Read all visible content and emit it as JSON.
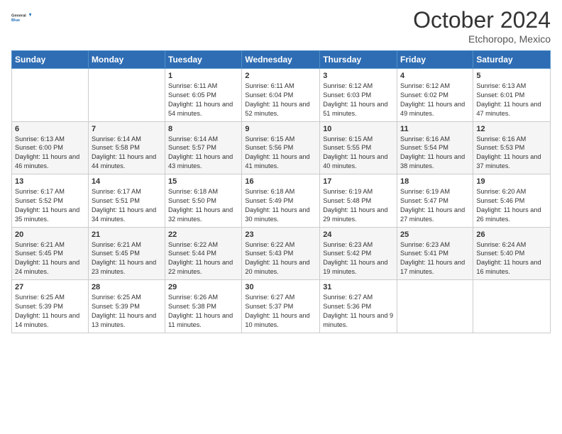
{
  "header": {
    "logo_text_general": "General",
    "logo_text_blue": "Blue",
    "month": "October 2024",
    "location": "Etchoropo, Mexico"
  },
  "weekdays": [
    "Sunday",
    "Monday",
    "Tuesday",
    "Wednesday",
    "Thursday",
    "Friday",
    "Saturday"
  ],
  "weeks": [
    [
      {
        "day": "",
        "sunrise": "",
        "sunset": "",
        "daylight": ""
      },
      {
        "day": "",
        "sunrise": "",
        "sunset": "",
        "daylight": ""
      },
      {
        "day": "1",
        "sunrise": "Sunrise: 6:11 AM",
        "sunset": "Sunset: 6:05 PM",
        "daylight": "Daylight: 11 hours and 54 minutes."
      },
      {
        "day": "2",
        "sunrise": "Sunrise: 6:11 AM",
        "sunset": "Sunset: 6:04 PM",
        "daylight": "Daylight: 11 hours and 52 minutes."
      },
      {
        "day": "3",
        "sunrise": "Sunrise: 6:12 AM",
        "sunset": "Sunset: 6:03 PM",
        "daylight": "Daylight: 11 hours and 51 minutes."
      },
      {
        "day": "4",
        "sunrise": "Sunrise: 6:12 AM",
        "sunset": "Sunset: 6:02 PM",
        "daylight": "Daylight: 11 hours and 49 minutes."
      },
      {
        "day": "5",
        "sunrise": "Sunrise: 6:13 AM",
        "sunset": "Sunset: 6:01 PM",
        "daylight": "Daylight: 11 hours and 47 minutes."
      }
    ],
    [
      {
        "day": "6",
        "sunrise": "Sunrise: 6:13 AM",
        "sunset": "Sunset: 6:00 PM",
        "daylight": "Daylight: 11 hours and 46 minutes."
      },
      {
        "day": "7",
        "sunrise": "Sunrise: 6:14 AM",
        "sunset": "Sunset: 5:58 PM",
        "daylight": "Daylight: 11 hours and 44 minutes."
      },
      {
        "day": "8",
        "sunrise": "Sunrise: 6:14 AM",
        "sunset": "Sunset: 5:57 PM",
        "daylight": "Daylight: 11 hours and 43 minutes."
      },
      {
        "day": "9",
        "sunrise": "Sunrise: 6:15 AM",
        "sunset": "Sunset: 5:56 PM",
        "daylight": "Daylight: 11 hours and 41 minutes."
      },
      {
        "day": "10",
        "sunrise": "Sunrise: 6:15 AM",
        "sunset": "Sunset: 5:55 PM",
        "daylight": "Daylight: 11 hours and 40 minutes."
      },
      {
        "day": "11",
        "sunrise": "Sunrise: 6:16 AM",
        "sunset": "Sunset: 5:54 PM",
        "daylight": "Daylight: 11 hours and 38 minutes."
      },
      {
        "day": "12",
        "sunrise": "Sunrise: 6:16 AM",
        "sunset": "Sunset: 5:53 PM",
        "daylight": "Daylight: 11 hours and 37 minutes."
      }
    ],
    [
      {
        "day": "13",
        "sunrise": "Sunrise: 6:17 AM",
        "sunset": "Sunset: 5:52 PM",
        "daylight": "Daylight: 11 hours and 35 minutes."
      },
      {
        "day": "14",
        "sunrise": "Sunrise: 6:17 AM",
        "sunset": "Sunset: 5:51 PM",
        "daylight": "Daylight: 11 hours and 34 minutes."
      },
      {
        "day": "15",
        "sunrise": "Sunrise: 6:18 AM",
        "sunset": "Sunset: 5:50 PM",
        "daylight": "Daylight: 11 hours and 32 minutes."
      },
      {
        "day": "16",
        "sunrise": "Sunrise: 6:18 AM",
        "sunset": "Sunset: 5:49 PM",
        "daylight": "Daylight: 11 hours and 30 minutes."
      },
      {
        "day": "17",
        "sunrise": "Sunrise: 6:19 AM",
        "sunset": "Sunset: 5:48 PM",
        "daylight": "Daylight: 11 hours and 29 minutes."
      },
      {
        "day": "18",
        "sunrise": "Sunrise: 6:19 AM",
        "sunset": "Sunset: 5:47 PM",
        "daylight": "Daylight: 11 hours and 27 minutes."
      },
      {
        "day": "19",
        "sunrise": "Sunrise: 6:20 AM",
        "sunset": "Sunset: 5:46 PM",
        "daylight": "Daylight: 11 hours and 26 minutes."
      }
    ],
    [
      {
        "day": "20",
        "sunrise": "Sunrise: 6:21 AM",
        "sunset": "Sunset: 5:45 PM",
        "daylight": "Daylight: 11 hours and 24 minutes."
      },
      {
        "day": "21",
        "sunrise": "Sunrise: 6:21 AM",
        "sunset": "Sunset: 5:45 PM",
        "daylight": "Daylight: 11 hours and 23 minutes."
      },
      {
        "day": "22",
        "sunrise": "Sunrise: 6:22 AM",
        "sunset": "Sunset: 5:44 PM",
        "daylight": "Daylight: 11 hours and 22 minutes."
      },
      {
        "day": "23",
        "sunrise": "Sunrise: 6:22 AM",
        "sunset": "Sunset: 5:43 PM",
        "daylight": "Daylight: 11 hours and 20 minutes."
      },
      {
        "day": "24",
        "sunrise": "Sunrise: 6:23 AM",
        "sunset": "Sunset: 5:42 PM",
        "daylight": "Daylight: 11 hours and 19 minutes."
      },
      {
        "day": "25",
        "sunrise": "Sunrise: 6:23 AM",
        "sunset": "Sunset: 5:41 PM",
        "daylight": "Daylight: 11 hours and 17 minutes."
      },
      {
        "day": "26",
        "sunrise": "Sunrise: 6:24 AM",
        "sunset": "Sunset: 5:40 PM",
        "daylight": "Daylight: 11 hours and 16 minutes."
      }
    ],
    [
      {
        "day": "27",
        "sunrise": "Sunrise: 6:25 AM",
        "sunset": "Sunset: 5:39 PM",
        "daylight": "Daylight: 11 hours and 14 minutes."
      },
      {
        "day": "28",
        "sunrise": "Sunrise: 6:25 AM",
        "sunset": "Sunset: 5:39 PM",
        "daylight": "Daylight: 11 hours and 13 minutes."
      },
      {
        "day": "29",
        "sunrise": "Sunrise: 6:26 AM",
        "sunset": "Sunset: 5:38 PM",
        "daylight": "Daylight: 11 hours and 11 minutes."
      },
      {
        "day": "30",
        "sunrise": "Sunrise: 6:27 AM",
        "sunset": "Sunset: 5:37 PM",
        "daylight": "Daylight: 11 hours and 10 minutes."
      },
      {
        "day": "31",
        "sunrise": "Sunrise: 6:27 AM",
        "sunset": "Sunset: 5:36 PM",
        "daylight": "Daylight: 11 hours and 9 minutes."
      },
      {
        "day": "",
        "sunrise": "",
        "sunset": "",
        "daylight": ""
      },
      {
        "day": "",
        "sunrise": "",
        "sunset": "",
        "daylight": ""
      }
    ]
  ]
}
